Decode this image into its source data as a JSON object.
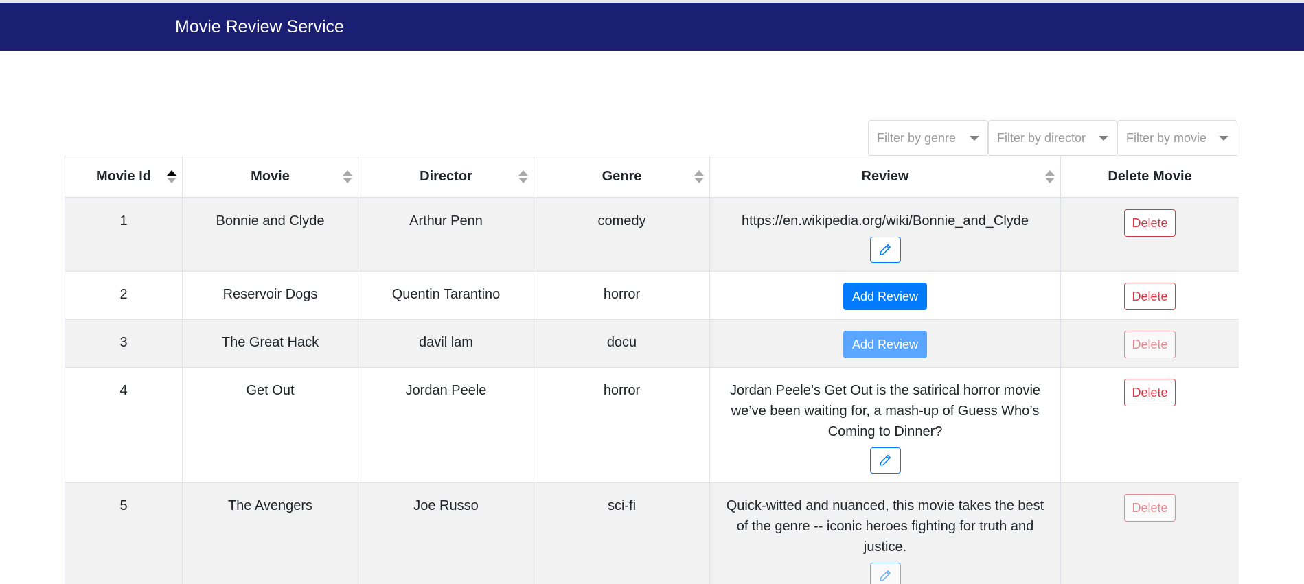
{
  "app": {
    "title": "Movie Review Service"
  },
  "filters": {
    "genre_placeholder": "Filter by genre",
    "director_placeholder": "Filter by director",
    "movie_placeholder": "Filter by movie"
  },
  "table": {
    "columns": {
      "id": "Movie Id",
      "movie": "Movie",
      "director": "Director",
      "genre": "Genre",
      "review": "Review",
      "delete": "Delete Movie"
    },
    "rows": [
      {
        "id": "1",
        "movie": "Bonnie and Clyde",
        "director": "Arthur Penn",
        "genre": "comedy",
        "review": "https://en.wikipedia.org/wiki/Bonnie_and_Clyde",
        "delete_label": "Delete"
      },
      {
        "id": "2",
        "movie": "Reservoir Dogs",
        "director": "Quentin Tarantino",
        "genre": "horror",
        "add_review_label": "Add Review",
        "delete_label": "Delete"
      },
      {
        "id": "3",
        "movie": "The Great Hack",
        "director": "davil lam",
        "genre": "docu",
        "add_review_label": "Add Review",
        "delete_label": "Delete"
      },
      {
        "id": "4",
        "movie": "Get Out",
        "director": "Jordan Peele",
        "genre": "horror",
        "review": "Jordan Peele’s Get Out is the satirical horror movie we’ve been waiting for, a mash-up of Guess Who’s Coming to Dinner?",
        "delete_label": "Delete"
      },
      {
        "id": "5",
        "movie": "The Avengers",
        "director": "Joe Russo",
        "genre": "sci-fi",
        "review": "Quick-witted and nuanced, this movie takes the best of the genre -- iconic heroes fighting for truth and justice.",
        "delete_label": "Delete"
      }
    ]
  },
  "icons": {
    "edit": "pencil-icon",
    "sort": "sort-icon",
    "dropdown": "chevron-down-icon"
  },
  "colors": {
    "navbar": "#1b1f73",
    "primary": "#007bff",
    "danger": "#dc3545",
    "row_alt": "#f2f2f2"
  }
}
